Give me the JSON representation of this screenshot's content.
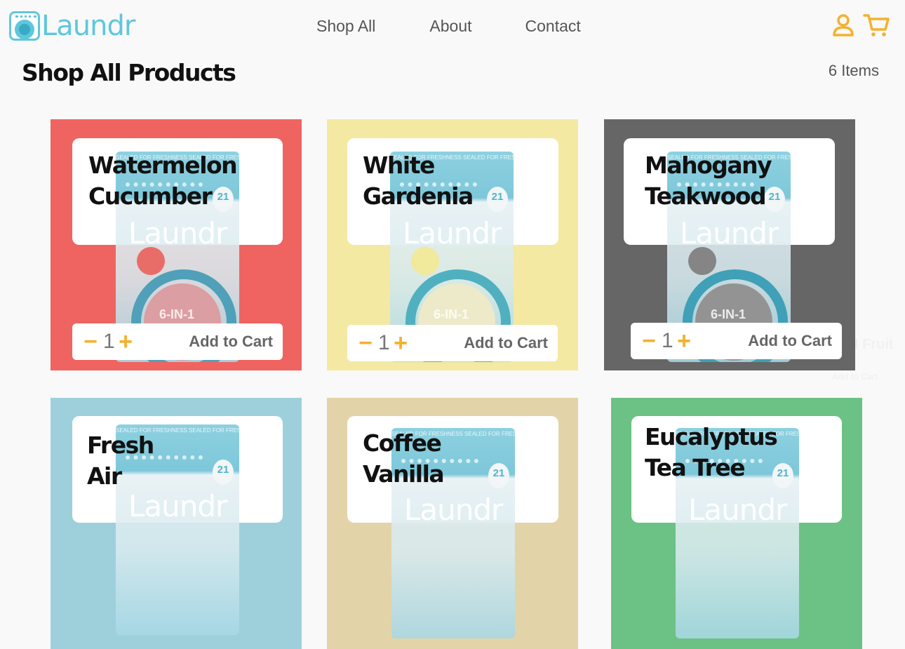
{
  "brand": {
    "name": "Laundr"
  },
  "nav": {
    "items": [
      "Shop All",
      "About",
      "Contact"
    ]
  },
  "header_icons": [
    "user-icon",
    "cart-icon"
  ],
  "page": {
    "title": "Shop All Products",
    "item_count": "6 Items"
  },
  "colors": {
    "brand": "#5fc7dc",
    "accent": "#f4b12f",
    "watermelon": "#ef6461",
    "gardenia": "#f4e9a3",
    "mahogany": "#666666",
    "fresh_air": "#9ed0dc",
    "coffee": "#e3d3a9",
    "eucalyptus": "#6cc284"
  },
  "bag": {
    "band": "SEALED FOR FRESHNESS  SEALED FOR FRESHNESS  SEAL",
    "count": "21",
    "brand": "Laundr",
    "variant": "6-IN-1"
  },
  "products": [
    {
      "name_line1": "Watermelon",
      "name_line2": "Cucumber",
      "quantity": "1",
      "add_label": "Add to Cart"
    },
    {
      "name_line1": "White",
      "name_line2": "Gardenia",
      "quantity": "1",
      "add_label": "Add to Cart"
    },
    {
      "name_line1": "Mahogany",
      "name_line2": "Teakwood",
      "quantity": "1",
      "add_label": "Add to Cart"
    },
    {
      "name_line1": "Fresh",
      "name_line2": "Air"
    },
    {
      "name_line1": "Coffee",
      "name_line2": "Vanilla"
    },
    {
      "name_line1": "Eucalyptus",
      "name_line2": "Tea Tree"
    }
  ],
  "ghost_text": {
    "line1": "l Fruit",
    "line2": "Add to Cart"
  }
}
